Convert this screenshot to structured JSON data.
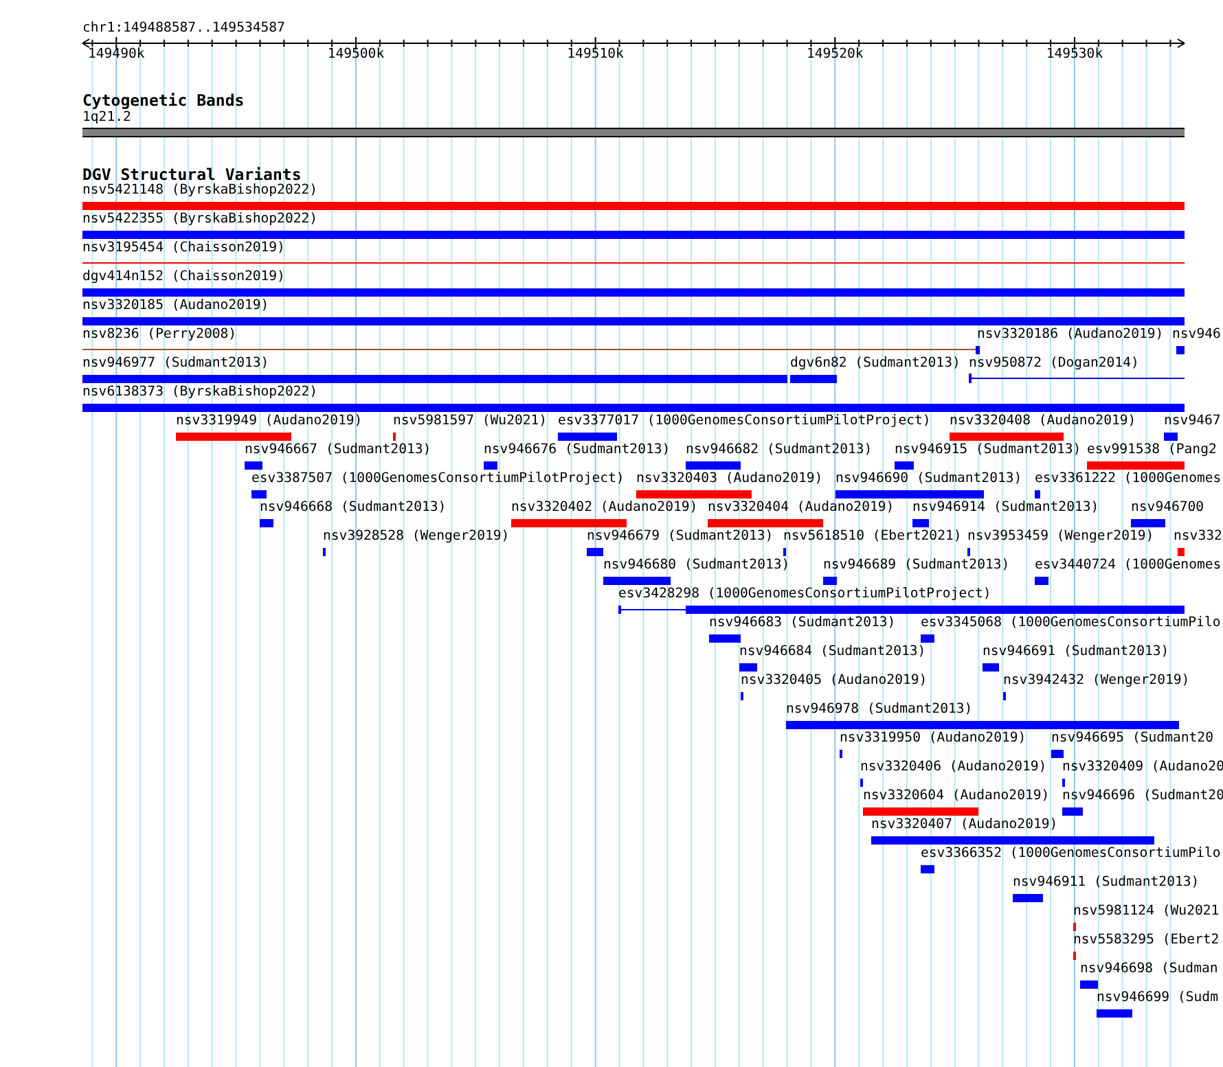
{
  "ruler": {
    "region": "chr1:149488587..149534587",
    "ticks": [
      "149490k",
      "149500k",
      "149510k",
      "149520k",
      "149530k"
    ]
  },
  "cytobands": {
    "title": "Cytogenetic Bands",
    "band": {
      "label": "1q21.2",
      "color": "#808080"
    }
  },
  "variants": {
    "title": "DGV Structural Variants",
    "rows": [
      {
        "features": [
          {
            "label": "nsv5421148 (ByrskaBishop2022)",
            "color": "#ff0000",
            "kind": "bar"
          }
        ]
      },
      {
        "features": [
          {
            "label": "nsv5422355 (ByrskaBishop2022)",
            "color": "#0000ff",
            "kind": "bar"
          }
        ]
      },
      {
        "features": [
          {
            "label": "nsv3195454 (Chaisson2019)",
            "color": "#ff0000",
            "kind": "line"
          }
        ]
      },
      {
        "features": [
          {
            "label": "dgv414n152 (Chaisson2019)",
            "color": "#0000ff",
            "kind": "bar"
          }
        ]
      },
      {
        "features": [
          {
            "label": "nsv3320185 (Audano2019)",
            "color": "#0000ff",
            "kind": "bar"
          }
        ]
      },
      {
        "features": [
          {
            "label": "nsv8236 (Perry2008)",
            "color": "#a0522d",
            "kind": "line"
          },
          {
            "label": "nsv3320186 (Audano2019)",
            "color": "#0000ff",
            "kind": "bar"
          },
          {
            "label": "nsv946",
            "color": "#0000ff",
            "kind": "bar"
          }
        ]
      },
      {
        "features": [
          {
            "label": "nsv946977 (Sudmant2013)",
            "color": "#0000ff",
            "kind": "bar"
          },
          {
            "label": "dgv6n82 (Sudmant2013)",
            "color": "#0000ff",
            "kind": "bar"
          },
          {
            "label": "nsv950872 (Dogan2014)",
            "color": "#0000ff",
            "kind": "ticked-line"
          }
        ]
      },
      {
        "features": [
          {
            "label": "nsv6138373 (ByrskaBishop2022)",
            "color": "#0000ff",
            "kind": "bar"
          }
        ]
      },
      {
        "features": [
          {
            "label": "nsv3319949 (Audano2019)",
            "color": "#ff0000",
            "kind": "bar"
          },
          {
            "label": "nsv5981597 (Wu2021)",
            "color": "#ff0000",
            "kind": "bar"
          },
          {
            "label": "esv3377017 (1000GenomesConsortiumPilotProject)",
            "color": "#0000ff",
            "kind": "bar"
          },
          {
            "label": "nsv3320408 (Audano2019)",
            "color": "#ff0000",
            "kind": "bar"
          },
          {
            "label": "nsv9467",
            "color": "#0000ff",
            "kind": "bar"
          }
        ]
      },
      {
        "features": [
          {
            "label": "nsv946667 (Sudmant2013)",
            "color": "#0000ff",
            "kind": "bar"
          },
          {
            "label": "nsv946676 (Sudmant2013)",
            "color": "#0000ff",
            "kind": "bar"
          },
          {
            "label": "nsv946682 (Sudmant2013)",
            "color": "#0000ff",
            "kind": "bar"
          },
          {
            "label": "nsv946915 (Sudmant2013)",
            "color": "#0000ff",
            "kind": "bar"
          },
          {
            "label": "esv991538 (Pang2",
            "color": "#ff0000",
            "kind": "bar"
          }
        ]
      },
      {
        "features": [
          {
            "label": "esv3387507 (1000GenomesConsortiumPilotProject)",
            "color": "#0000ff",
            "kind": "bar"
          },
          {
            "label": "nsv3320403 (Audano2019)",
            "color": "#ff0000",
            "kind": "bar"
          },
          {
            "label": "nsv946690 (Sudmant2013)",
            "color": "#0000ff",
            "kind": "bar"
          },
          {
            "label": "esv3361222 (1000Genomes",
            "color": "#0000ff",
            "kind": "bar"
          }
        ]
      },
      {
        "features": [
          {
            "label": "nsv946668 (Sudmant2013)",
            "color": "#0000ff",
            "kind": "bar"
          },
          {
            "label": "nsv3320402 (Audano2019)",
            "color": "#ff0000",
            "kind": "bar"
          },
          {
            "label": "nsv3320404 (Audano2019)",
            "color": "#ff0000",
            "kind": "bar"
          },
          {
            "label": "nsv946914 (Sudmant2013)",
            "color": "#0000ff",
            "kind": "bar"
          },
          {
            "label": "nsv946700",
            "color": "#0000ff",
            "kind": "bar"
          }
        ]
      },
      {
        "features": [
          {
            "label": "nsv3928528 (Wenger2019)",
            "color": "#0000ff",
            "kind": "bar"
          },
          {
            "label": "nsv946679 (Sudmant2013)",
            "color": "#0000ff",
            "kind": "bar"
          },
          {
            "label": "nsv5618510 (Ebert2021)",
            "color": "#0000ff",
            "kind": "bar"
          },
          {
            "label": "nsv3953459 (Wenger2019)",
            "color": "#0000ff",
            "kind": "bar"
          },
          {
            "label": "nsv332",
            "color": "#ff0000",
            "kind": "bar"
          }
        ]
      },
      {
        "features": [
          {
            "label": "nsv946680 (Sudmant2013)",
            "color": "#0000ff",
            "kind": "bar"
          },
          {
            "label": "nsv946689 (Sudmant2013)",
            "color": "#0000ff",
            "kind": "bar"
          },
          {
            "label": "esv3440724 (1000Genomes",
            "color": "#0000ff",
            "kind": "bar"
          }
        ]
      },
      {
        "features": [
          {
            "label": "esv3428298 (1000GenomesConsortiumPilotProject)",
            "color": "#0000ff",
            "kind": "gapped"
          }
        ]
      },
      {
        "features": [
          {
            "label": "nsv946683 (Sudmant2013)",
            "color": "#0000ff",
            "kind": "bar"
          },
          {
            "label": "esv3345068 (1000GenomesConsortiumPilo",
            "color": "#0000ff",
            "kind": "bar"
          }
        ]
      },
      {
        "features": [
          {
            "label": "nsv946684 (Sudmant2013)",
            "color": "#0000ff",
            "kind": "bar"
          },
          {
            "label": "nsv946691 (Sudmant2013)",
            "color": "#0000ff",
            "kind": "bar"
          }
        ]
      },
      {
        "features": [
          {
            "label": "nsv3320405 (Audano2019)",
            "color": "#0000ff",
            "kind": "bar"
          },
          {
            "label": "nsv3942432 (Wenger2019)",
            "color": "#0000ff",
            "kind": "bar"
          }
        ]
      },
      {
        "features": [
          {
            "label": "nsv946978 (Sudmant2013)",
            "color": "#0000ff",
            "kind": "bar"
          }
        ]
      },
      {
        "features": [
          {
            "label": "nsv3319950 (Audano2019)",
            "color": "#0000ff",
            "kind": "bar"
          },
          {
            "label": "nsv946695 (Sudmant20",
            "color": "#0000ff",
            "kind": "bar"
          }
        ]
      },
      {
        "features": [
          {
            "label": "nsv3320406 (Audano2019)",
            "color": "#0000ff",
            "kind": "bar"
          },
          {
            "label": "nsv3320409 (Audano20",
            "color": "#0000ff",
            "kind": "bar"
          }
        ]
      },
      {
        "features": [
          {
            "label": "nsv3320604 (Audano2019)",
            "color": "#ff0000",
            "kind": "bar"
          },
          {
            "label": "nsv946696 (Sudmant20",
            "color": "#0000ff",
            "kind": "bar"
          }
        ]
      },
      {
        "features": [
          {
            "label": "nsv3320407 (Audano2019)",
            "color": "#0000ff",
            "kind": "bar"
          }
        ]
      },
      {
        "features": [
          {
            "label": "esv3366352 (1000GenomesConsortiumPilo",
            "color": "#0000ff",
            "kind": "bar"
          }
        ]
      },
      {
        "features": [
          {
            "label": "nsv946911 (Sudmant2013)",
            "color": "#0000ff",
            "kind": "bar"
          }
        ]
      },
      {
        "features": [
          {
            "label": "nsv5981124 (Wu2021",
            "color": "#ff0000",
            "kind": "bar"
          }
        ]
      },
      {
        "features": [
          {
            "label": "nsv5583295 (Ebert2",
            "color": "#ff0000",
            "kind": "bar"
          }
        ]
      },
      {
        "features": [
          {
            "label": "nsv946698 (Sudman",
            "color": "#0000ff",
            "kind": "bar"
          }
        ]
      },
      {
        "features": [
          {
            "label": "nsv946699 (Sudm",
            "color": "#0000ff",
            "kind": "bar"
          }
        ]
      }
    ]
  }
}
